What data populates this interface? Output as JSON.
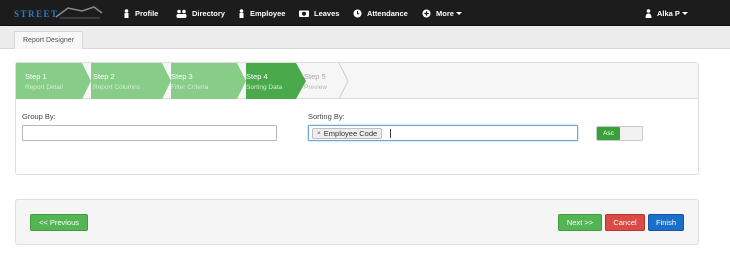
{
  "brand": {
    "logo_text": "STREET"
  },
  "nav": {
    "items": [
      {
        "label": "Profile",
        "icon": "person-icon"
      },
      {
        "label": "Directory",
        "icon": "group-icon"
      },
      {
        "label": "Employee",
        "icon": "person-icon"
      },
      {
        "label": "Leaves",
        "icon": "camera-icon"
      },
      {
        "label": "Attendance",
        "icon": "clock-icon"
      },
      {
        "label": "More",
        "icon": "plus-circle-icon"
      }
    ],
    "user": "Alka P"
  },
  "subnav": {
    "tab": "Report Designer"
  },
  "wizard": {
    "steps": [
      {
        "title": "Step 1",
        "subtitle": "Report Detail",
        "state": "done"
      },
      {
        "title": "Step 2",
        "subtitle": "Report Columns",
        "state": "done"
      },
      {
        "title": "Step 3",
        "subtitle": "Filter Criteria",
        "state": "done"
      },
      {
        "title": "Step 4",
        "subtitle": "Sorting Data",
        "state": "active"
      },
      {
        "title": "Step 5",
        "subtitle": "Preview",
        "state": "todo"
      }
    ],
    "group_by_label": "Group By:",
    "group_by_value": "",
    "sorting_by_label": "Sorting By:",
    "sorting_tag": "Employee Code",
    "sort_order": "Asc"
  },
  "footer": {
    "previous": "<< Previous",
    "next": "Next >>",
    "cancel": "Cancel",
    "finish": "Finish"
  },
  "colors": {
    "navbar": "#1c1c1c",
    "step_done": "#87cc87",
    "step_active": "#4aa94a",
    "success": "#55b555",
    "danger": "#d94b44",
    "primary": "#1b6fcb"
  }
}
